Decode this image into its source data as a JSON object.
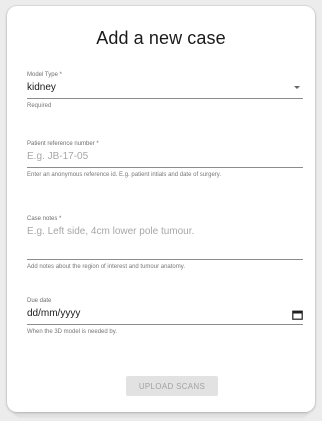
{
  "form": {
    "title": "Add a new case",
    "fields": {
      "model_type": {
        "label": "Model Type *",
        "value": "kidney",
        "helper": "Required"
      },
      "patient_reference": {
        "label": "Patient reference number *",
        "placeholder": "E.g. JB-17-05",
        "helper": "Enter an anonymous reference id. E.g. patient intials and date of surgery."
      },
      "case_notes": {
        "label": "Case notes *",
        "placeholder": "E.g. Left side, 4cm lower pole tumour.",
        "helper": "Add notes about the region of interest and tumour anatomy."
      },
      "due_date": {
        "label": "Due date",
        "value": "dd/mm/yyyy",
        "helper": "When the 3D model is needed by."
      }
    },
    "upload_button_label": "UPLOAD SCANS"
  },
  "icons": {
    "dropdown": "chevron-down-icon",
    "date": "calendar-icon"
  }
}
